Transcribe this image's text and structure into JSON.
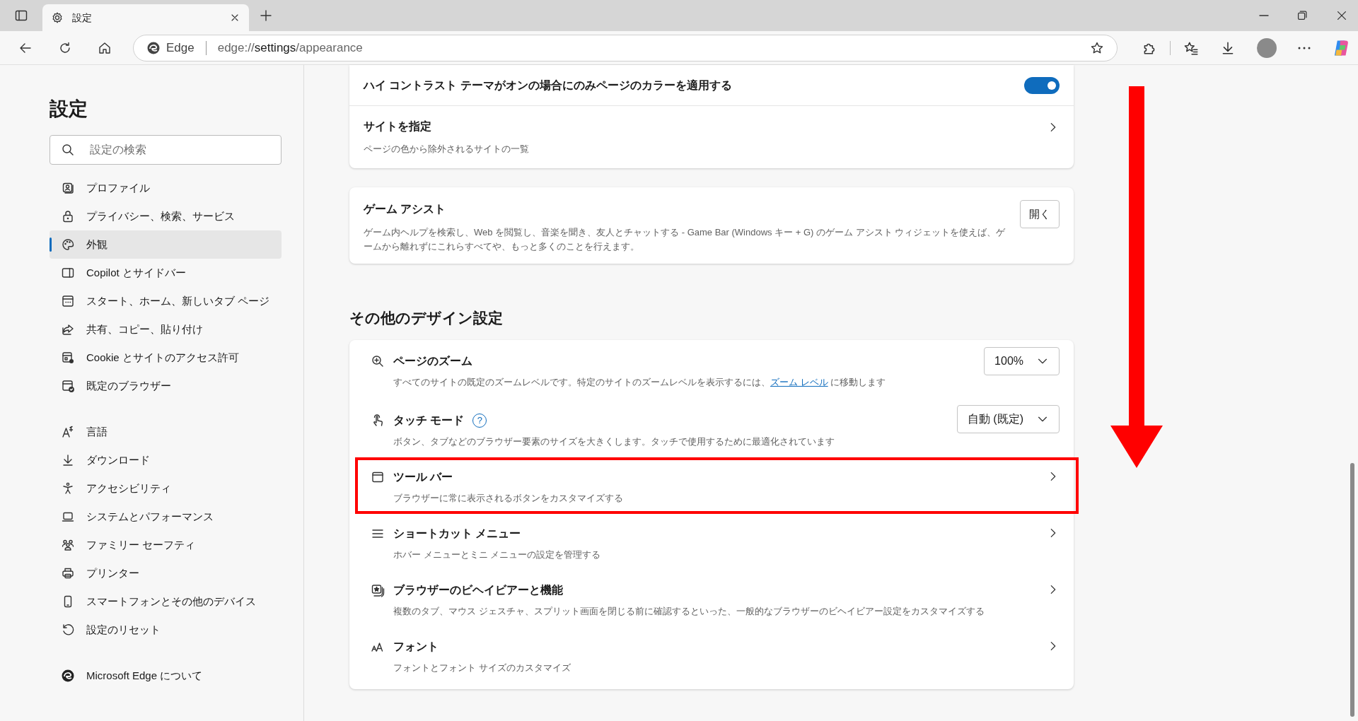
{
  "browser": {
    "tab": {
      "title": "設定",
      "selected": true
    },
    "address": {
      "site_label": "Edge",
      "url_prefix": "edge://",
      "url_host": "settings",
      "url_path": "/appearance"
    }
  },
  "sidebar": {
    "title": "設定",
    "search": {
      "placeholder": "設定の検索"
    },
    "groups": [
      [
        {
          "label": "プロファイル",
          "selected": false
        },
        {
          "label": "プライバシー、検索、サービス",
          "selected": false
        },
        {
          "label": "外観",
          "selected": true
        },
        {
          "label": "Copilot とサイドバー",
          "selected": false
        },
        {
          "label": "スタート、ホーム、新しいタブ ページ",
          "selected": false
        },
        {
          "label": "共有、コピー、貼り付け",
          "selected": false
        },
        {
          "label": "Cookie とサイトのアクセス許可",
          "selected": false
        },
        {
          "label": "既定のブラウザー",
          "selected": false
        }
      ],
      [
        {
          "label": "言語",
          "selected": false
        },
        {
          "label": "ダウンロード",
          "selected": false
        },
        {
          "label": "アクセシビリティ",
          "selected": false
        },
        {
          "label": "システムとパフォーマンス",
          "selected": false
        },
        {
          "label": "ファミリー セーフティ",
          "selected": false
        },
        {
          "label": "プリンター",
          "selected": false
        },
        {
          "label": "スマートフォンとその他のデバイス",
          "selected": false
        },
        {
          "label": "設定のリセット",
          "selected": false
        }
      ],
      [
        {
          "label": "Microsoft Edge について",
          "selected": false
        }
      ]
    ]
  },
  "content": {
    "cards": [
      {
        "rows": [
          {
            "kind": "toggle",
            "title": "ハイ コントラスト テーマがオンの場合にのみページのカラーを適用する",
            "on": true
          },
          {
            "kind": "link",
            "title": "サイトを指定",
            "description": "ページの色から除外されるサイトの一覧"
          }
        ]
      },
      {
        "rows": [
          {
            "kind": "button",
            "title": "ゲーム アシスト",
            "description": "ゲーム内ヘルプを検索し、Web を閲覧し、音楽を聞き、友人とチャットする - Game Bar (Windows キー + G) のゲーム アシスト ウィジェットを使えば、ゲームから離れずにこれらすべてや、もっと多くのことを行えます。",
            "button": "開く"
          }
        ]
      }
    ],
    "section_heading": "その他のデザイン設定",
    "design_rows": [
      {
        "kind": "dropdown",
        "title": "ページのズーム",
        "description": "すべてのサイトの既定のズームレベルです。特定のサイトのズームレベルを表示するには、",
        "link": "ズーム レベル",
        "description_after": " に移動します",
        "value": "100%",
        "highlighted": false
      },
      {
        "kind": "dropdown",
        "title": "タッチ モード",
        "help": "?",
        "description": "ボタン、タブなどのブラウザー要素のサイズを大きくします。タッチで使用するために最適化されています",
        "value": "自動 (既定)",
        "highlighted": false
      },
      {
        "kind": "link",
        "title": "ツール バー",
        "description": "ブラウザーに常に表示されるボタンをカスタマイズする",
        "highlighted": true
      },
      {
        "kind": "link",
        "title": "ショートカット メニュー",
        "description": "ホバー メニューとミニ メニューの設定を管理する",
        "highlighted": false
      },
      {
        "kind": "link",
        "title": "ブラウザーのビヘイビアーと機能",
        "description": "複数のタブ、マウス ジェスチャ、スプリット画面を閉じる前に確認するといった、一般的なブラウザーのビヘイビアー設定をカスタマイズする",
        "highlighted": false
      },
      {
        "kind": "link",
        "title": "フォント",
        "description": "フォントとフォント サイズのカスタマイズ",
        "highlighted": false
      }
    ]
  }
}
